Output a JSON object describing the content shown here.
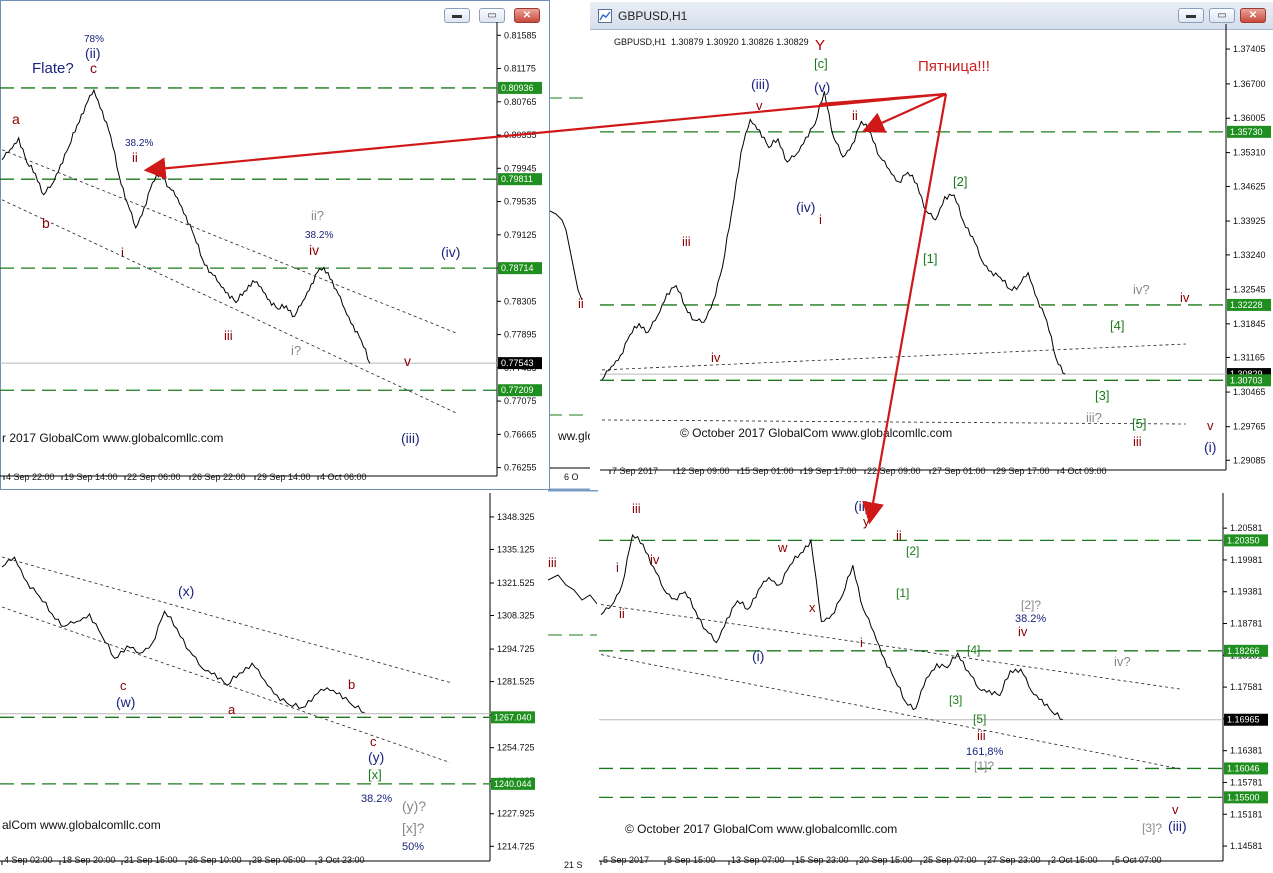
{
  "windows": {
    "top_right": {
      "title": "GBPUSD,H1",
      "info_line": "GBPUSD,H1  1.30879 1.30920 1.30826 1.30829",
      "annotation": "Пятница!!!",
      "copyright": "© October 2017 GlobalCom www.globalcomllc.com",
      "buttons": {
        "minimize": "▬",
        "maximize": "▭",
        "close": "✕"
      }
    },
    "top_left": {
      "copyright": "r 2017 GlobalCom www.globalcomllc.com",
      "buttons": {
        "minimize": "▬",
        "maximize": "▭",
        "close": "✕"
      }
    },
    "bottom_left": {
      "copyright": "alCom www.globalcomllc.com"
    },
    "bottom_right": {
      "copyright": "© October 2017 GlobalCom www.globalcomllc.com"
    },
    "middle_strip": {
      "copyright": "ww.glo"
    }
  },
  "chart_data": [
    {
      "id": "top_left",
      "type": "line",
      "ylim": [
        0.7625,
        0.8165
      ],
      "y_ticks": [
        "0.81585",
        "0.81175",
        "0.80765",
        "0.80355",
        "0.79945",
        "0.79535",
        "0.79125",
        "0.78715",
        "0.78305",
        "0.77895",
        "0.77485",
        "0.77075",
        "0.76665",
        "0.76255"
      ],
      "x_ticks": [
        "4 Sep 22:00",
        "19 Sep 14:00",
        "22 Sep 06:00",
        "26 Sep 22:00",
        "29 Sep 14:00",
        "4 Oct 06:00"
      ],
      "price_labels": [
        {
          "value": 0.80936,
          "text": "0.80936",
          "style": "green"
        },
        {
          "value": 0.79811,
          "text": "0.79811",
          "style": "green"
        },
        {
          "value": 0.78714,
          "text": "0.78714",
          "style": "green"
        },
        {
          "value": 0.77543,
          "text": "0.77543",
          "style": "black"
        },
        {
          "value": 0.77209,
          "text": "0.77209",
          "style": "green"
        }
      ],
      "levels": [
        0.80936,
        0.79811,
        0.78714,
        0.77209
      ],
      "current": 0.77543,
      "prices": [
        0.8005,
        0.8018,
        0.8032,
        0.8001,
        0.7988,
        0.7962,
        0.7975,
        0.7999,
        0.8021,
        0.8048,
        0.8072,
        0.8091,
        0.8065,
        0.8034,
        0.7986,
        0.7952,
        0.7921,
        0.7946,
        0.7977,
        0.7989,
        0.7971,
        0.7958,
        0.7936,
        0.7911,
        0.7882,
        0.7866,
        0.7853,
        0.7841,
        0.7829,
        0.7843,
        0.7856,
        0.7848,
        0.7832,
        0.7821,
        0.7825,
        0.7812,
        0.7831,
        0.7852,
        0.7871,
        0.7866,
        0.7845,
        0.7821,
        0.7801,
        0.7782,
        0.7754
      ],
      "labels": [
        {
          "text": "78%",
          "color": "#1a237e"
        },
        {
          "text": "(ii)",
          "color": "#1a237e"
        },
        {
          "text": "Flate?",
          "color": "#1a237e"
        },
        {
          "text": "c",
          "color": "#8b0000"
        },
        {
          "text": "a",
          "color": "#8b0000"
        },
        {
          "text": "b",
          "color": "#8b0000"
        },
        {
          "text": "38.2%",
          "color": "#1a237e"
        },
        {
          "text": "ii",
          "color": "#8b0000"
        },
        {
          "text": "i",
          "color": "#8b0000"
        },
        {
          "text": "ii?",
          "color": "#888888"
        },
        {
          "text": "38.2%",
          "color": "#1a237e"
        },
        {
          "text": "iv",
          "color": "#8b0000"
        },
        {
          "text": "iii",
          "color": "#8b0000"
        },
        {
          "text": "i?",
          "color": "#888888"
        },
        {
          "text": "(iv)",
          "color": "#1a237e"
        },
        {
          "text": "v",
          "color": "#8b0000"
        },
        {
          "text": "(iii)",
          "color": "#1a237e"
        }
      ]
    },
    {
      "id": "top_right",
      "type": "line",
      "ylim": [
        1.2905,
        1.3775
      ],
      "y_ticks": [
        "1.37405",
        "1.36700",
        "1.36005",
        "1.35310",
        "1.34625",
        "1.33925",
        "1.33240",
        "1.32545",
        "1.31845",
        "1.31165",
        "1.30465",
        "1.29765",
        "1.29085"
      ],
      "x_ticks": [
        "7 Sep 2017",
        "12 Sep 09:00",
        "15 Sep 01:00",
        "19 Sep 17:00",
        "22 Sep 09:00",
        "27 Sep 01:00",
        "29 Sep 17:00",
        "4 Oct 09:00"
      ],
      "price_labels": [
        {
          "value": 1.3573,
          "text": "1.35730",
          "style": "green"
        },
        {
          "value": 1.32228,
          "text": "1.32228",
          "style": "green"
        },
        {
          "value": 1.30829,
          "text": "1.30829",
          "style": "black"
        },
        {
          "value": 1.30703,
          "text": "1.30703",
          "style": "green"
        }
      ],
      "levels": [
        1.3573,
        1.32228,
        1.30703
      ],
      "current": 1.30829,
      "prices": [
        1.3071,
        1.3098,
        1.3121,
        1.3162,
        1.3185,
        1.3168,
        1.3201,
        1.3246,
        1.3262,
        1.3219,
        1.3192,
        1.3188,
        1.3231,
        1.3299,
        1.3411,
        1.3532,
        1.3598,
        1.3577,
        1.3541,
        1.3559,
        1.3512,
        1.3528,
        1.3562,
        1.3589,
        1.3655,
        1.3562,
        1.3522,
        1.3548,
        1.3594,
        1.3571,
        1.3522,
        1.3497,
        1.3472,
        1.3491,
        1.3468,
        1.3412,
        1.3395,
        1.3442,
        1.3445,
        1.3392,
        1.3361,
        1.3312,
        1.3291,
        1.3278,
        1.3255,
        1.3262,
        1.3288,
        1.3235,
        1.3191,
        1.3115,
        1.3083
      ],
      "labels": [
        {
          "text": "Y",
          "color": "#b00000"
        },
        {
          "text": "[c]",
          "color": "#1b7a1b"
        },
        {
          "text": "(iii)",
          "color": "#1a237e"
        },
        {
          "text": "(v)",
          "color": "#1a237e"
        },
        {
          "text": "v",
          "color": "#8b0000"
        },
        {
          "text": "ii",
          "color": "#8b0000"
        },
        {
          "text": "iii",
          "color": "#8b0000"
        },
        {
          "text": "iv",
          "color": "#8b0000"
        },
        {
          "text": "(iv)",
          "color": "#1a237e"
        },
        {
          "text": "i",
          "color": "#8b0000"
        },
        {
          "text": "[2]",
          "color": "#1b7a1b"
        },
        {
          "text": "[1]",
          "color": "#1b7a1b"
        },
        {
          "text": "[4]",
          "color": "#1b7a1b"
        },
        {
          "text": "[3]",
          "color": "#1b7a1b"
        },
        {
          "text": "iii?",
          "color": "#888888"
        },
        {
          "text": "[5]",
          "color": "#1b7a1b"
        },
        {
          "text": "iii",
          "color": "#8b0000"
        },
        {
          "text": "iv?",
          "color": "#888888"
        },
        {
          "text": "iv",
          "color": "#8b0000"
        },
        {
          "text": "v",
          "color": "#8b0000"
        },
        {
          "text": "(i)",
          "color": "#1a237e"
        }
      ]
    },
    {
      "id": "bottom_left",
      "type": "line",
      "ylim": [
        1212,
        1356
      ],
      "y_ticks": [
        "1348.325",
        "1335.125",
        "1321.525",
        "1308.325",
        "1294.725",
        "1281.525",
        "1267.925",
        "1254.725",
        "1241.125",
        "1227.925",
        "1214.725"
      ],
      "x_ticks": [
        "4 Sep 02:00",
        "18 Sep 20:00",
        "21 Sep 15:00",
        "26 Sep 10:00",
        "29 Sep 05:00",
        "3 Oct 23:00"
      ],
      "price_labels": [
        {
          "value": 1267.04,
          "text": "1267.040",
          "style": "green"
        },
        {
          "value": 1240.044,
          "text": "1240.044",
          "style": "green"
        }
      ],
      "levels": [
        1267.04,
        1240.044
      ],
      "current": 1268.5,
      "prices": [
        1328,
        1332,
        1322,
        1316,
        1309,
        1304,
        1306,
        1309,
        1300,
        1291,
        1296,
        1293,
        1297,
        1310,
        1303,
        1294,
        1287,
        1285,
        1280,
        1285,
        1289,
        1282,
        1276,
        1272,
        1271,
        1276,
        1279,
        1277,
        1272,
        1269
      ],
      "labels": [
        {
          "text": "(x)",
          "color": "#1a237e"
        },
        {
          "text": "c",
          "color": "#8b0000"
        },
        {
          "text": "(w)",
          "color": "#1a237e"
        },
        {
          "text": "a",
          "color": "#8b0000"
        },
        {
          "text": "b",
          "color": "#8b0000"
        },
        {
          "text": "c",
          "color": "#8b0000"
        },
        {
          "text": "(y)",
          "color": "#1a237e"
        },
        {
          "text": "[x]",
          "color": "#1b7a1b"
        },
        {
          "text": "38.2%",
          "color": "#1a237e"
        },
        {
          "text": "(y)?",
          "color": "#888888"
        },
        {
          "text": "[x]?",
          "color": "#888888"
        },
        {
          "text": "50%",
          "color": "#1a237e"
        }
      ]
    },
    {
      "id": "bottom_right",
      "type": "line",
      "ylim": [
        1.1445,
        1.2115
      ],
      "y_ticks": [
        "1.20581",
        "1.19981",
        "1.19381",
        "1.18781",
        "1.18181",
        "1.17581",
        "1.16981",
        "1.16381",
        "1.15781",
        "1.15181",
        "1.14581"
      ],
      "x_ticks": [
        "5 Sep 2017",
        "8 Sep 15:00",
        "13 Sep 07:00",
        "15 Sep 23:00",
        "20 Sep 15:00",
        "25 Sep 07:00",
        "27 Sep 23:00",
        "2 Oct 15:00",
        "5 Oct 07:00"
      ],
      "price_labels": [
        {
          "value": 1.2035,
          "text": "1.20350",
          "style": "green"
        },
        {
          "value": 1.18266,
          "text": "1.18266",
          "style": "green"
        },
        {
          "value": 1.16965,
          "text": "1.16965",
          "style": "black"
        },
        {
          "value": 1.16046,
          "text": "1.16046",
          "style": "green"
        },
        {
          "value": 1.155,
          "text": "1.15500",
          "style": "green"
        }
      ],
      "levels": [
        1.2035,
        1.18266,
        1.16046,
        1.155
      ],
      "current": 1.16965,
      "prices": [
        1.1895,
        1.1912,
        1.1951,
        1.2045,
        1.2028,
        1.1985,
        1.1942,
        1.1925,
        1.1938,
        1.1902,
        1.1866,
        1.1842,
        1.1888,
        1.1921,
        1.1905,
        1.1942,
        1.1965,
        1.1951,
        1.1988,
        1.2011,
        1.2035,
        1.1882,
        1.1895,
        1.1931,
        1.1988,
        1.1905,
        1.1862,
        1.1812,
        1.1772,
        1.1731,
        1.1718,
        1.1775,
        1.1802,
        1.1795,
        1.1822,
        1.1788,
        1.1755,
        1.1752,
        1.1742,
        1.1789,
        1.1792,
        1.1751,
        1.1735,
        1.1711,
        1.1697
      ],
      "labels": [
        {
          "text": "iii",
          "color": "#8b0000"
        },
        {
          "text": "i",
          "color": "#8b0000"
        },
        {
          "text": "ii",
          "color": "#8b0000"
        },
        {
          "text": "iv",
          "color": "#8b0000"
        },
        {
          "text": "(ii)",
          "color": "#1a237e"
        },
        {
          "text": "y",
          "color": "#8b0000"
        },
        {
          "text": "w",
          "color": "#8b0000"
        },
        {
          "text": "x",
          "color": "#8b0000"
        },
        {
          "text": "ii",
          "color": "#8b0000"
        },
        {
          "text": "[2]",
          "color": "#1b7a1b"
        },
        {
          "text": "[1]",
          "color": "#1b7a1b"
        },
        {
          "text": "(i)",
          "color": "#1a237e"
        },
        {
          "text": "i",
          "color": "#8b0000"
        },
        {
          "text": "[2]?",
          "color": "#888888"
        },
        {
          "text": "38.2%",
          "color": "#1a237e"
        },
        {
          "text": "iv",
          "color": "#8b0000"
        },
        {
          "text": "[4]",
          "color": "#1b7a1b"
        },
        {
          "text": "[3]",
          "color": "#1b7a1b"
        },
        {
          "text": "[5]",
          "color": "#1b7a1b"
        },
        {
          "text": "iii",
          "color": "#8b0000"
        },
        {
          "text": "161,8%",
          "color": "#1a237e"
        },
        {
          "text": "[1]?",
          "color": "#888888"
        },
        {
          "text": "iv?",
          "color": "#888888"
        },
        {
          "text": "v",
          "color": "#8b0000"
        },
        {
          "text": "[3]?",
          "color": "#888888"
        },
        {
          "text": "(iii)",
          "color": "#1a237e"
        }
      ]
    },
    {
      "id": "middle_strip",
      "type": "line",
      "y_ticks": [],
      "x_ticks": [
        "6 O",
        "21 S"
      ],
      "labels": [
        {
          "text": "ii",
          "color": "#8b0000"
        },
        {
          "text": "iii",
          "color": "#8b0000"
        }
      ]
    }
  ]
}
